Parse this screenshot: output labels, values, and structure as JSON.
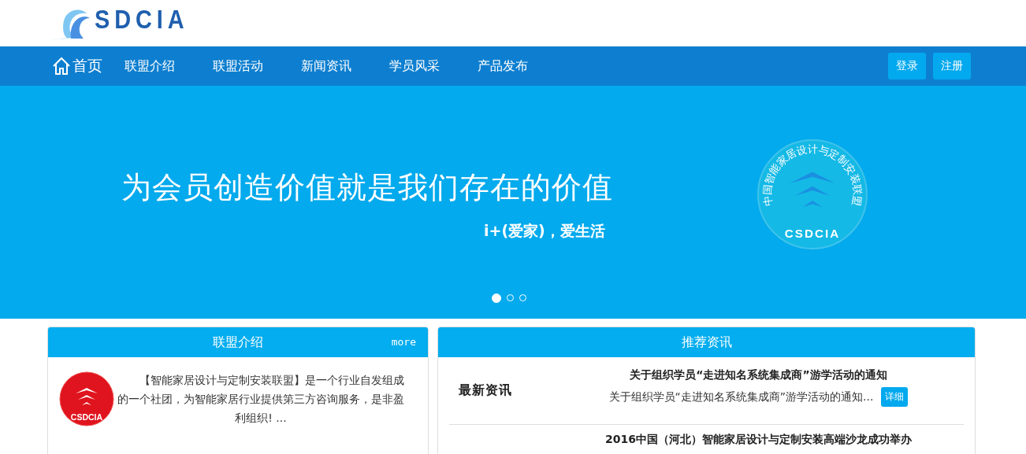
{
  "header": {
    "logo_text": "SDCIA"
  },
  "nav": {
    "home": "首页",
    "items": [
      {
        "label": "联盟介绍"
      },
      {
        "label": "联盟活动"
      },
      {
        "label": "新闻资讯"
      },
      {
        "label": "学员风采"
      },
      {
        "label": "产品发布"
      }
    ],
    "buttons": [
      "登录",
      "注册"
    ]
  },
  "banner": {
    "slogan": "为会员创造价值就是我们存在的价值",
    "subslogan": "i+(爱家)，爱生活",
    "badge_ring_text": "中国智能家居设计与定制安装联盟",
    "badge_text": "CSDCIA",
    "dots": [
      {
        "selected": true
      },
      {
        "selected": false
      },
      {
        "selected": false
      }
    ]
  },
  "intro_panel": {
    "title": "联盟介绍",
    "more": "more",
    "badge_text": "CSDCIA",
    "text": "【智能家居设计与定制安装联盟】是一个行业自发组成的一个社团，为智能家居行业提供第三方咨询服务，是非盈利组织! ..."
  },
  "news_panel": {
    "title": "推荐资讯",
    "items": [
      {
        "thumb_label": "最新资讯",
        "title": "关于组织学员“走进知名系统集成商”游学活动的通知",
        "summary": "关于组织学员“走进知名系统集成商”游学活动的通知...",
        "button": "详细"
      },
      {
        "title": "2016中国（河北）智能家居设计与定制安装高端沙龙成功举办"
      }
    ]
  }
}
